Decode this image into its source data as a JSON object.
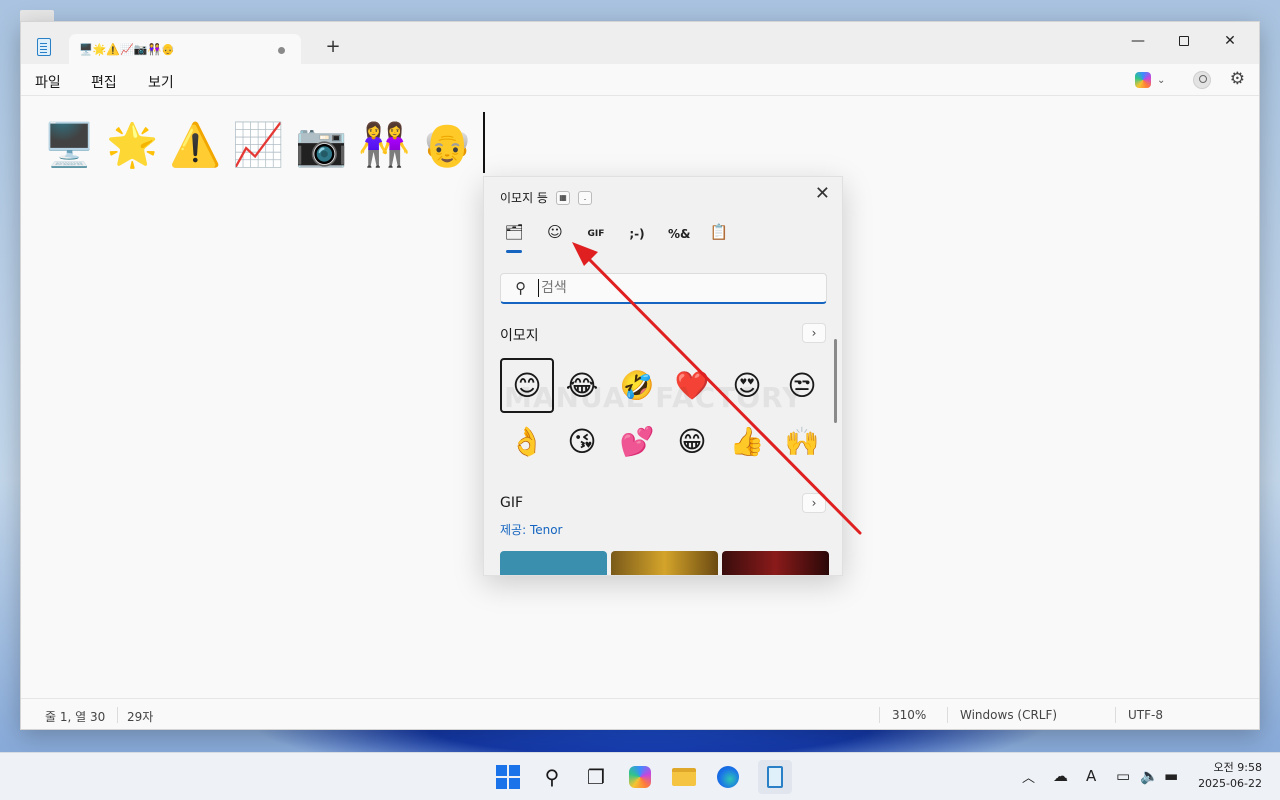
{
  "window": {
    "tab_title": "🖥️🌟⚠️📈📷👭👴",
    "new_tab": "+",
    "min": "—",
    "close": "✕"
  },
  "menu": {
    "file": "파일",
    "edit": "편집",
    "view": "보기"
  },
  "editor": {
    "emojis": [
      "🖥️",
      "🌟",
      "⚠️",
      "📈",
      "📷",
      "👭",
      "👴"
    ]
  },
  "status": {
    "position": "줄 1, 열 30",
    "chars": "29자",
    "zoom": "310%",
    "line_ending": "Windows (CRLF)",
    "encoding": "UTF-8"
  },
  "panel": {
    "title": "이모지 등",
    "close": "✕",
    "tabs": [
      "🗂",
      "☺",
      "GIF",
      ";-)",
      "%&",
      "📋"
    ],
    "search_placeholder": "검색",
    "emoji_section": "이모지",
    "emojis": [
      "😊",
      "😂",
      "🤣",
      "❤️",
      "😍",
      "😒",
      "👌",
      "😘",
      "💕",
      "😁",
      "👍",
      "🙌"
    ],
    "gif_section": "GIF",
    "provider": "제공: Tenor",
    "watermark": "MANUAL FACTORY",
    "chevron": "›"
  },
  "tray": {
    "time": "오전 9:58",
    "date": "2025-06-22"
  },
  "colors": {
    "accent": "#1565c0",
    "annotation_arrow": "#e02020"
  }
}
